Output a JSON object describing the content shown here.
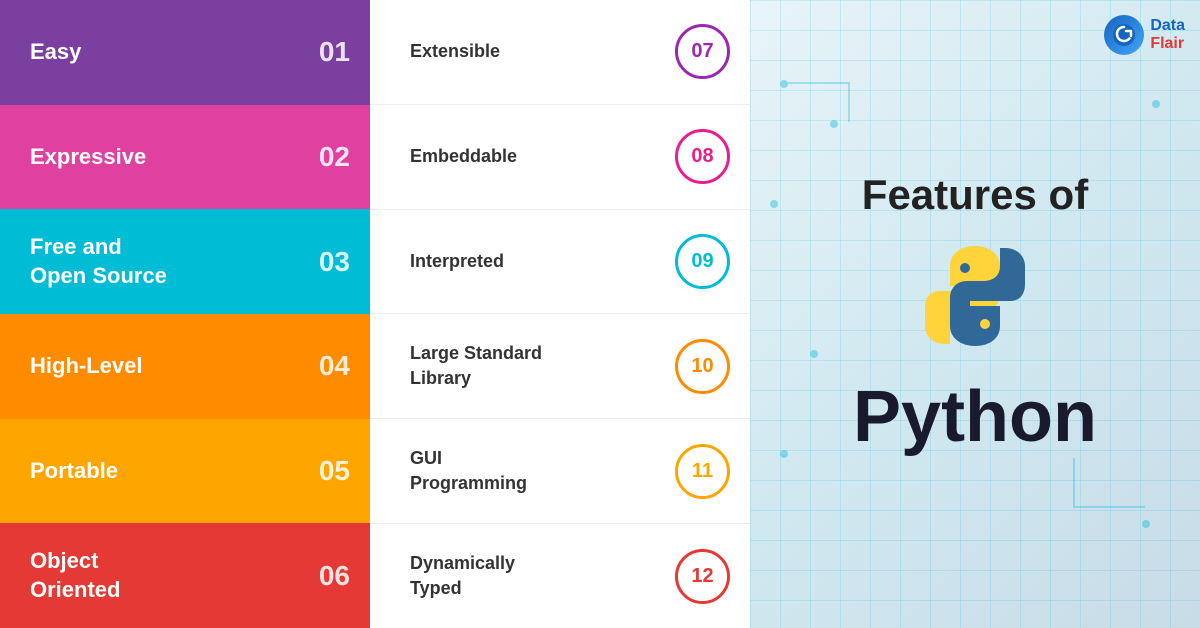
{
  "brand": {
    "name": "Data Flair",
    "data_label": "Data",
    "flair_label": "Flair"
  },
  "page_title": "Features of",
  "subject_title": "Python",
  "left_features": [
    {
      "id": 1,
      "label": "Easy",
      "number": "01",
      "color_class": "item-1"
    },
    {
      "id": 2,
      "label": "Expressive",
      "number": "02",
      "color_class": "item-2"
    },
    {
      "id": 3,
      "label": "Free and\nOpen Source",
      "number": "03",
      "color_class": "item-3"
    },
    {
      "id": 4,
      "label": "High-Level",
      "number": "04",
      "color_class": "item-4"
    },
    {
      "id": 5,
      "label": "Portable",
      "number": "05",
      "color_class": "item-5"
    },
    {
      "id": 6,
      "label": "Object\nOriented",
      "number": "06",
      "color_class": "item-6"
    }
  ],
  "right_features": [
    {
      "id": 7,
      "label": "Extensible",
      "number": "07",
      "circle_class": "circle-purple"
    },
    {
      "id": 8,
      "label": "Embeddable",
      "number": "08",
      "circle_class": "circle-pink"
    },
    {
      "id": 9,
      "label": "Interpreted",
      "number": "09",
      "circle_class": "circle-cyan"
    },
    {
      "id": 10,
      "label": "Large Standard\nLibrary",
      "number": "10",
      "circle_class": "circle-orange"
    },
    {
      "id": 11,
      "label": "GUI\nProgramming",
      "number": "11",
      "circle_class": "circle-orange2"
    },
    {
      "id": 12,
      "label": "Dynamically\nTyped",
      "number": "12",
      "circle_class": "circle-red"
    }
  ]
}
